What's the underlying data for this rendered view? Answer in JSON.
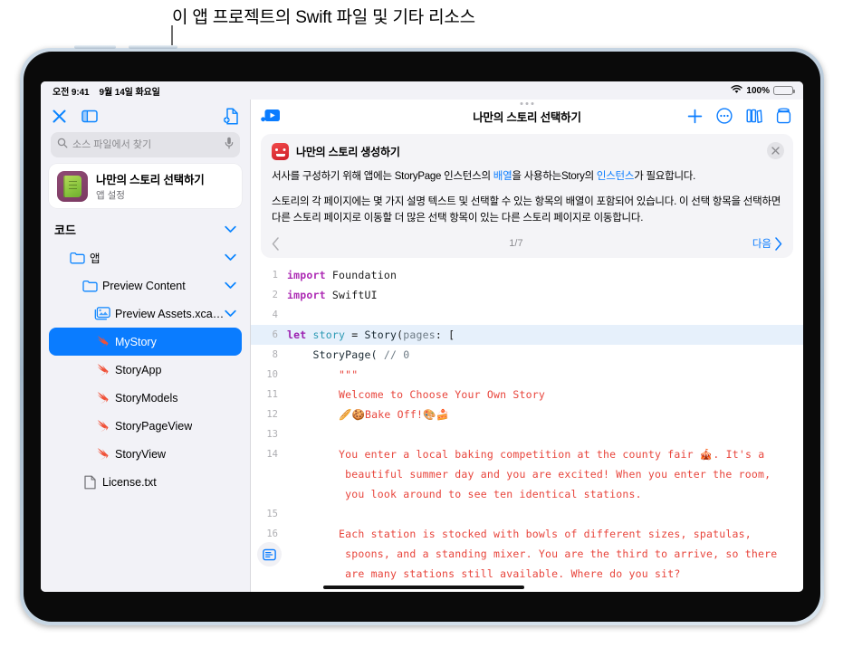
{
  "callout": {
    "text": "이 앱 프로젝트의 Swift 파일 및 기타 리소스"
  },
  "status_bar": {
    "time": "오전 9:41",
    "date": "9월 14일 화요일",
    "battery_percent": "100%",
    "wifi_icon": "wifi-icon",
    "battery_icon": "battery-icon"
  },
  "sidebar": {
    "toolbar": {
      "close_icon": "close-icon",
      "sidebar_toggle_icon": "sidebar-toggle-icon",
      "new_file_icon": "new-file-icon"
    },
    "search": {
      "placeholder": "소스 파일에서 찾기",
      "value": "",
      "search_icon": "search-icon",
      "mic_icon": "microphone-icon"
    },
    "app_card": {
      "title": "나만의 스토리 선택하기",
      "subtitle": "앱 설정",
      "icon": "app-book-icon"
    },
    "tree": [
      {
        "label": "코드",
        "icon": "none",
        "depth": 0,
        "type": "header",
        "chevron": true,
        "selected": false
      },
      {
        "label": "앱",
        "icon": "folder-icon",
        "depth": 1,
        "type": "folder",
        "chevron": true,
        "selected": false
      },
      {
        "label": "Preview Content",
        "icon": "folder-icon",
        "depth": 2,
        "type": "folder",
        "chevron": true,
        "selected": false
      },
      {
        "label": "Preview Assets.xcass...",
        "icon": "assets-icon",
        "depth": 3,
        "type": "assets",
        "chevron": true,
        "selected": false
      },
      {
        "label": "MyStory",
        "icon": "swift-icon",
        "depth": 3,
        "type": "swift",
        "chevron": false,
        "selected": true
      },
      {
        "label": "StoryApp",
        "icon": "swift-icon",
        "depth": 3,
        "type": "swift",
        "chevron": false,
        "selected": false
      },
      {
        "label": "StoryModels",
        "icon": "swift-icon",
        "depth": 3,
        "type": "swift",
        "chevron": false,
        "selected": false
      },
      {
        "label": "StoryPageView",
        "icon": "swift-icon",
        "depth": 3,
        "type": "swift",
        "chevron": false,
        "selected": false
      },
      {
        "label": "StoryView",
        "icon": "swift-icon",
        "depth": 3,
        "type": "swift",
        "chevron": false,
        "selected": false
      },
      {
        "label": "License.txt",
        "icon": "text-file-icon",
        "depth": 2,
        "type": "text",
        "chevron": false,
        "selected": false
      }
    ]
  },
  "main": {
    "toolbar": {
      "run_icon": "run-preview-icon",
      "title": "나만의 스토리 선택하기",
      "add_icon": "plus-icon",
      "more_icon": "ellipsis-circle-icon",
      "library_icon": "library-icon",
      "package_icon": "package-icon"
    },
    "info_card": {
      "icon": "monster-icon",
      "title": "나만의 스토리 생성하기",
      "close_icon": "close-icon",
      "paragraph1_pre": "서사를 구성하기 위해 앱에는 StoryPage 인스턴스의 ",
      "paragraph1_link1": "배열",
      "paragraph1_mid": "을 사용하는Story의 ",
      "paragraph1_link2": "인스턴스",
      "paragraph1_post": "가 필요합니다.",
      "paragraph2": "스토리의 각 페이지에는 몇 가지 설명 텍스트 및 선택할 수 있는 항목의 배열이 포함되어 있습니다. 이 선택 항목을 선택하면 다른 스토리 페이지로 이동할 더 많은 선택 항목이 있는 다른 스토리 페이지로 이동합니다.",
      "pager_prev_icon": "chevron-left-icon",
      "pager_count": "1/7",
      "pager_next_label": "다음",
      "pager_next_icon": "chevron-right-icon"
    },
    "editor": {
      "minimap_icon": "minimap-icon",
      "lines": [
        {
          "num": "1",
          "highlight": false,
          "tokens": [
            {
              "t": "import",
              "c": "k-import"
            },
            {
              "t": " Foundation",
              "c": "k-plain"
            }
          ]
        },
        {
          "num": "2",
          "highlight": false,
          "tokens": [
            {
              "t": "import",
              "c": "k-import"
            },
            {
              "t": " SwiftUI",
              "c": "k-plain"
            }
          ]
        },
        {
          "num": "4",
          "highlight": false,
          "tokens": [
            {
              "t": "",
              "c": "k-plain"
            }
          ]
        },
        {
          "num": "6",
          "highlight": true,
          "tokens": [
            {
              "t": "let",
              "c": "k-let"
            },
            {
              "t": " ",
              "c": "k-plain"
            },
            {
              "t": "story",
              "c": "k-var"
            },
            {
              "t": " = ",
              "c": "k-plain"
            },
            {
              "t": "Story",
              "c": "k-type"
            },
            {
              "t": "(",
              "c": "k-plain"
            },
            {
              "t": "pages",
              "c": "k-param"
            },
            {
              "t": ": [",
              "c": "k-plain"
            }
          ]
        },
        {
          "num": "8",
          "highlight": false,
          "tokens": [
            {
              "t": "    StoryPage( ",
              "c": "k-type"
            },
            {
              "t": "// 0",
              "c": "k-cmt"
            }
          ]
        },
        {
          "num": "10",
          "highlight": false,
          "tokens": [
            {
              "t": "        \"\"\"",
              "c": "k-str"
            }
          ]
        },
        {
          "num": "11",
          "highlight": false,
          "tokens": [
            {
              "t": "        Welcome to Choose Your Own Story",
              "c": "k-str"
            }
          ]
        },
        {
          "num": "12",
          "highlight": false,
          "tokens": [
            {
              "t": "        🥖🍪Bake Off!🎨🍰",
              "c": "k-str"
            }
          ]
        },
        {
          "num": "13",
          "highlight": false,
          "tokens": [
            {
              "t": "",
              "c": "k-plain"
            }
          ]
        },
        {
          "num": "14",
          "highlight": false,
          "tokens": [
            {
              "t": "        You enter a local baking competition at the county fair 🎪. It's a",
              "c": "k-str"
            }
          ]
        },
        {
          "num": "",
          "highlight": false,
          "tokens": [
            {
              "t": "         beautiful summer day and you are excited! When you enter the room,",
              "c": "k-str"
            }
          ]
        },
        {
          "num": "",
          "highlight": false,
          "tokens": [
            {
              "t": "         you look around to see ten identical stations.",
              "c": "k-str"
            }
          ]
        },
        {
          "num": "15",
          "highlight": false,
          "tokens": [
            {
              "t": "",
              "c": "k-plain"
            }
          ]
        },
        {
          "num": "16",
          "highlight": false,
          "tokens": [
            {
              "t": "        Each station is stocked with bowls of different sizes, spatulas,",
              "c": "k-str"
            }
          ]
        },
        {
          "num": "",
          "highlight": false,
          "tokens": [
            {
              "t": "         spoons, and a standing mixer. You are the third to arrive, so there",
              "c": "k-str"
            }
          ]
        },
        {
          "num": "",
          "highlight": false,
          "tokens": [
            {
              "t": "         are many stations still available. Where do you sit?",
              "c": "k-str"
            }
          ]
        }
      ]
    }
  },
  "colors": {
    "accent_blue": "#0a7cff",
    "selection_blue": "#0a7cff",
    "sidebar_bg": "#f2f2f7",
    "card_bg": "#f4f4f7",
    "string_red": "#e8453c",
    "keyword_magenta": "#ad2bb4",
    "swift_orange": "#f05138"
  }
}
